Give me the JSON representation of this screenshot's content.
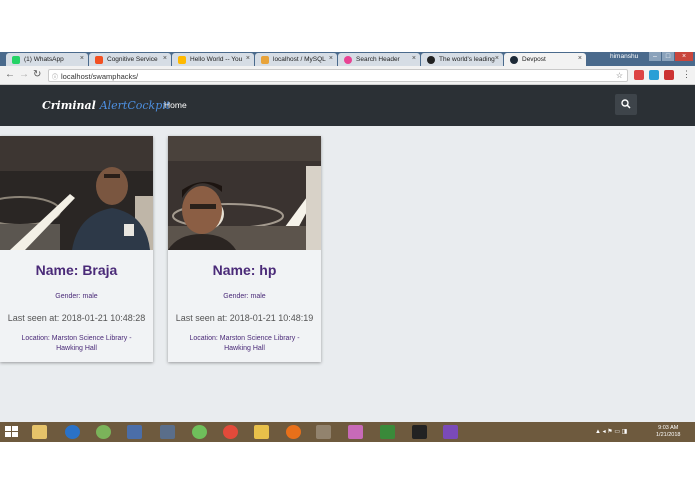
{
  "browser": {
    "tabs": [
      {
        "label": "(1) WhatsApp",
        "color": "#25d366"
      },
      {
        "label": "Cognitive Service",
        "color": "#f25022"
      },
      {
        "label": "Hello World -- You",
        "color": "#ffb900"
      },
      {
        "label": "localhost / MySQL",
        "color": "#e8a33a"
      },
      {
        "label": "Search Header",
        "color": "#e84393"
      },
      {
        "label": "The world's leading",
        "color": "#222222"
      },
      {
        "label": "Devpost",
        "color": "#1e2a38"
      }
    ],
    "user": "himanshu",
    "url": "localhost/swamphacks/"
  },
  "app": {
    "brand_first": "Criminal",
    "brand_second": "AlertCockpit",
    "nav_home": "Home"
  },
  "cards": [
    {
      "name": "Name: Braja",
      "gender": "Gender: male",
      "last_seen": "Last seen at: 2018-01-21 10:48:28",
      "location": "Location: Marston Science Library - Hawking Hall"
    },
    {
      "name": "Name: hp",
      "gender": "Gender: male",
      "last_seen": "Last seen at: 2018-01-21 10:48:19",
      "location": "Location: Marston Science Library - Hawking Hall"
    }
  ],
  "taskbar": {
    "time": "9:03 AM",
    "date": "1/21/2018"
  },
  "colors": {
    "navbar": "#2b3035",
    "brand_accent": "#4d8fe0",
    "name_text": "#4a2a78",
    "page_bg": "#e9ecef"
  }
}
